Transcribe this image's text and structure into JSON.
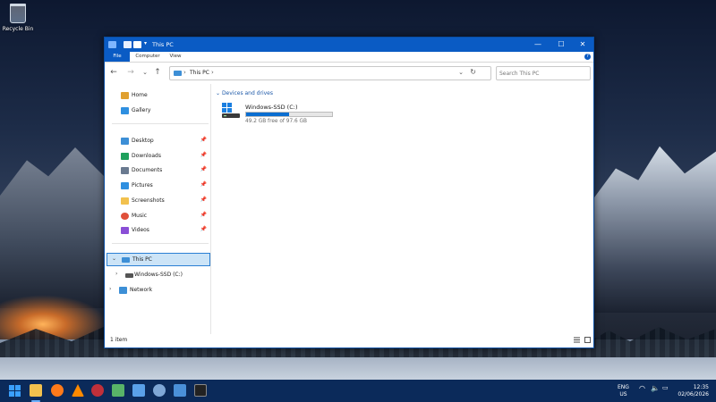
{
  "desktop": {
    "recycle_bin_label": "Recycle Bin"
  },
  "window": {
    "title": "This PC",
    "controls": {
      "minimize": "—",
      "maximize": "☐",
      "close": "✕"
    },
    "ribbon": {
      "tabs": [
        "File",
        "Computer",
        "View"
      ],
      "help": "?"
    }
  },
  "nav": {
    "back": "←",
    "forward": "→",
    "recent": "⌄",
    "up": "↑",
    "address": {
      "crumb": "This PC",
      "sep1": "›",
      "sep2": "›",
      "dropdown": "⌄",
      "refresh": "↻"
    },
    "search_placeholder": "Search This PC"
  },
  "sidebar": {
    "items": [
      {
        "label": "Home",
        "icon": "home-icon",
        "color": "#e0a030"
      },
      {
        "label": "Gallery",
        "icon": "gallery-icon",
        "color": "#2f8fe0"
      },
      {
        "label": "Desktop",
        "icon": "desktop-icon",
        "color": "#3d8fd6",
        "pin": "📌"
      },
      {
        "label": "Downloads",
        "icon": "download-icon",
        "color": "#1fa05c",
        "pin": "📌"
      },
      {
        "label": "Documents",
        "icon": "documents-icon",
        "color": "#6a7a90",
        "pin": "📌"
      },
      {
        "label": "Pictures",
        "icon": "pictures-icon",
        "color": "#2f8fe0",
        "pin": "📌"
      },
      {
        "label": "Screenshots",
        "icon": "folder-icon",
        "color": "#f2c14e",
        "pin": "📌"
      },
      {
        "label": "Music",
        "icon": "music-icon",
        "color": "#e0503a",
        "pin": "📌"
      },
      {
        "label": "Videos",
        "icon": "videos-icon",
        "color": "#8a4fd6",
        "pin": "📌"
      }
    ],
    "tree": [
      {
        "label": "This PC",
        "chevron": "⌄",
        "selected": true
      },
      {
        "label": "Windows-SSD (C:)",
        "chevron": "›"
      },
      {
        "label": "Network",
        "chevron": "›"
      }
    ]
  },
  "content": {
    "group_label": "Devices and drives",
    "drives": [
      {
        "name": "Windows-SSD (C:)",
        "free_text": "49.2 GB free of 97.6 GB",
        "used_fraction": 0.496
      }
    ]
  },
  "statusbar": {
    "count": "1 item"
  },
  "taskbar": {
    "apps": [
      {
        "name": "start-icon",
        "color": "#3aa0ff"
      },
      {
        "name": "file-explorer-icon",
        "color": "#f2c14e",
        "active": true
      },
      {
        "name": "firefox-icon",
        "color": "#ff7a1a"
      },
      {
        "name": "vlc-icon",
        "color": "#ff8a00"
      },
      {
        "name": "app-red-icon",
        "color": "#c0303a"
      },
      {
        "name": "notepad-icon",
        "color": "#58b368"
      },
      {
        "name": "document-icon",
        "color": "#5aa0e8"
      },
      {
        "name": "settings-icon",
        "color": "#7fa7d6"
      },
      {
        "name": "remote-desktop-icon",
        "color": "#4a90d9"
      },
      {
        "name": "terminal-icon",
        "color": "#222222"
      }
    ],
    "tray": {
      "lang_top": "ENG",
      "lang_bottom": "US"
    },
    "time": "12:35",
    "date": "02/06/2026"
  }
}
